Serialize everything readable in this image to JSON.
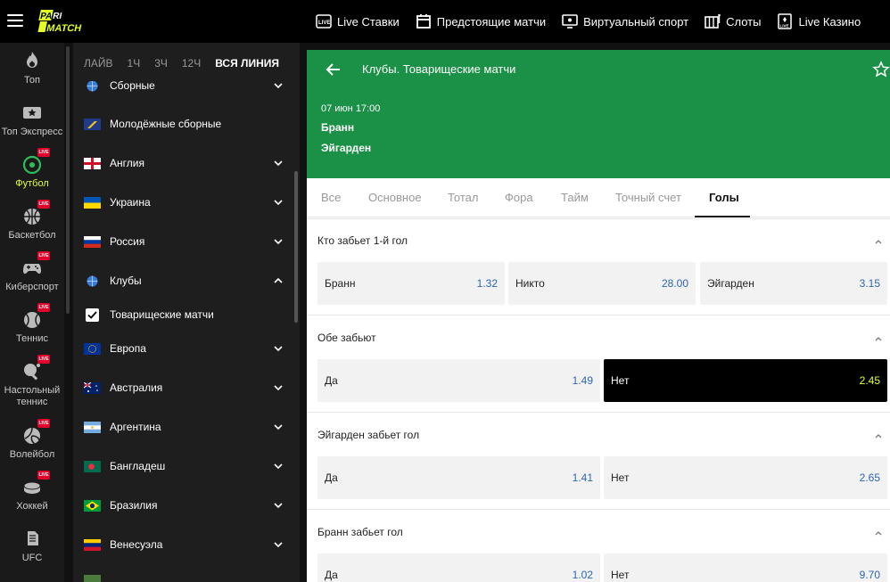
{
  "header": {
    "logo_text": "PARIMATCH",
    "nav": [
      {
        "label": "Live Ставки",
        "icon": "live-icon"
      },
      {
        "label": "Предстоящие матчи",
        "icon": "calendar-icon"
      },
      {
        "label": "Виртуальный спорт",
        "icon": "monitor-icon"
      },
      {
        "label": "Слоты",
        "icon": "slot-icon"
      },
      {
        "label": "Live Казино",
        "icon": "live-casino-icon"
      }
    ]
  },
  "sidebar": {
    "live_badge": "LIVE",
    "items": [
      {
        "label": "Топ",
        "icon": "flame-icon"
      },
      {
        "label": "Топ Экспресс",
        "icon": "ticket-star-icon"
      },
      {
        "label": "Футбол",
        "icon": "football-icon"
      },
      {
        "label": "Баскетбол",
        "icon": "basketball-icon"
      },
      {
        "label": "Киберспорт",
        "icon": "gamepad-icon"
      },
      {
        "label": "Теннис",
        "icon": "tennis-icon"
      },
      {
        "label": "Настольный теннис",
        "icon": "table-tennis-icon"
      },
      {
        "label": "Волейбол",
        "icon": "volleyball-icon"
      },
      {
        "label": "Хоккей",
        "icon": "hockey-puck-icon"
      },
      {
        "label": "UFC",
        "icon": "ufc-icon"
      }
    ]
  },
  "filters": {
    "items": [
      "ЛАЙВ",
      "1Ч",
      "3Ч",
      "12Ч",
      "ВСЯ ЛИНИЯ"
    ]
  },
  "categories": [
    {
      "label": "Сборные"
    },
    {
      "label": "Молодёжные сборные"
    },
    {
      "label": "Англия"
    },
    {
      "label": "Украина"
    },
    {
      "label": "Россия"
    },
    {
      "label": "Клубы"
    },
    {
      "label": "Товарищеские матчи"
    },
    {
      "label": "Европа"
    },
    {
      "label": "Австралия"
    },
    {
      "label": "Аргентина"
    },
    {
      "label": "Бангладеш"
    },
    {
      "label": "Бразилия"
    },
    {
      "label": "Венесуэла"
    }
  ],
  "event": {
    "league": "Клубы. Товарищеские матчи",
    "date": "07 июн 17:00",
    "team1": "Бранн",
    "team2": "Эйгарден"
  },
  "tabs": [
    "Все",
    "Основное",
    "Тотал",
    "Фора",
    "Тайм",
    "Точный счет",
    "Голы"
  ],
  "markets": [
    {
      "title": "Кто забьет 1-й гол",
      "odds": [
        {
          "label": "Бранн",
          "value": "1.32"
        },
        {
          "label": "Никто",
          "value": "28.00"
        },
        {
          "label": "Эйгарден",
          "value": "3.15"
        }
      ]
    },
    {
      "title": "Обе забьют",
      "odds": [
        {
          "label": "Да",
          "value": "1.49"
        },
        {
          "label": "Нет",
          "value": "2.45"
        }
      ]
    },
    {
      "title": "Эйгарден забьет гол",
      "odds": [
        {
          "label": "Да",
          "value": "1.41"
        },
        {
          "label": "Нет",
          "value": "2.65"
        }
      ]
    },
    {
      "title": "Бранн забьет гол",
      "odds": [
        {
          "label": "Да",
          "value": "1.02"
        },
        {
          "label": "Нет",
          "value": "9.70"
        }
      ]
    }
  ]
}
